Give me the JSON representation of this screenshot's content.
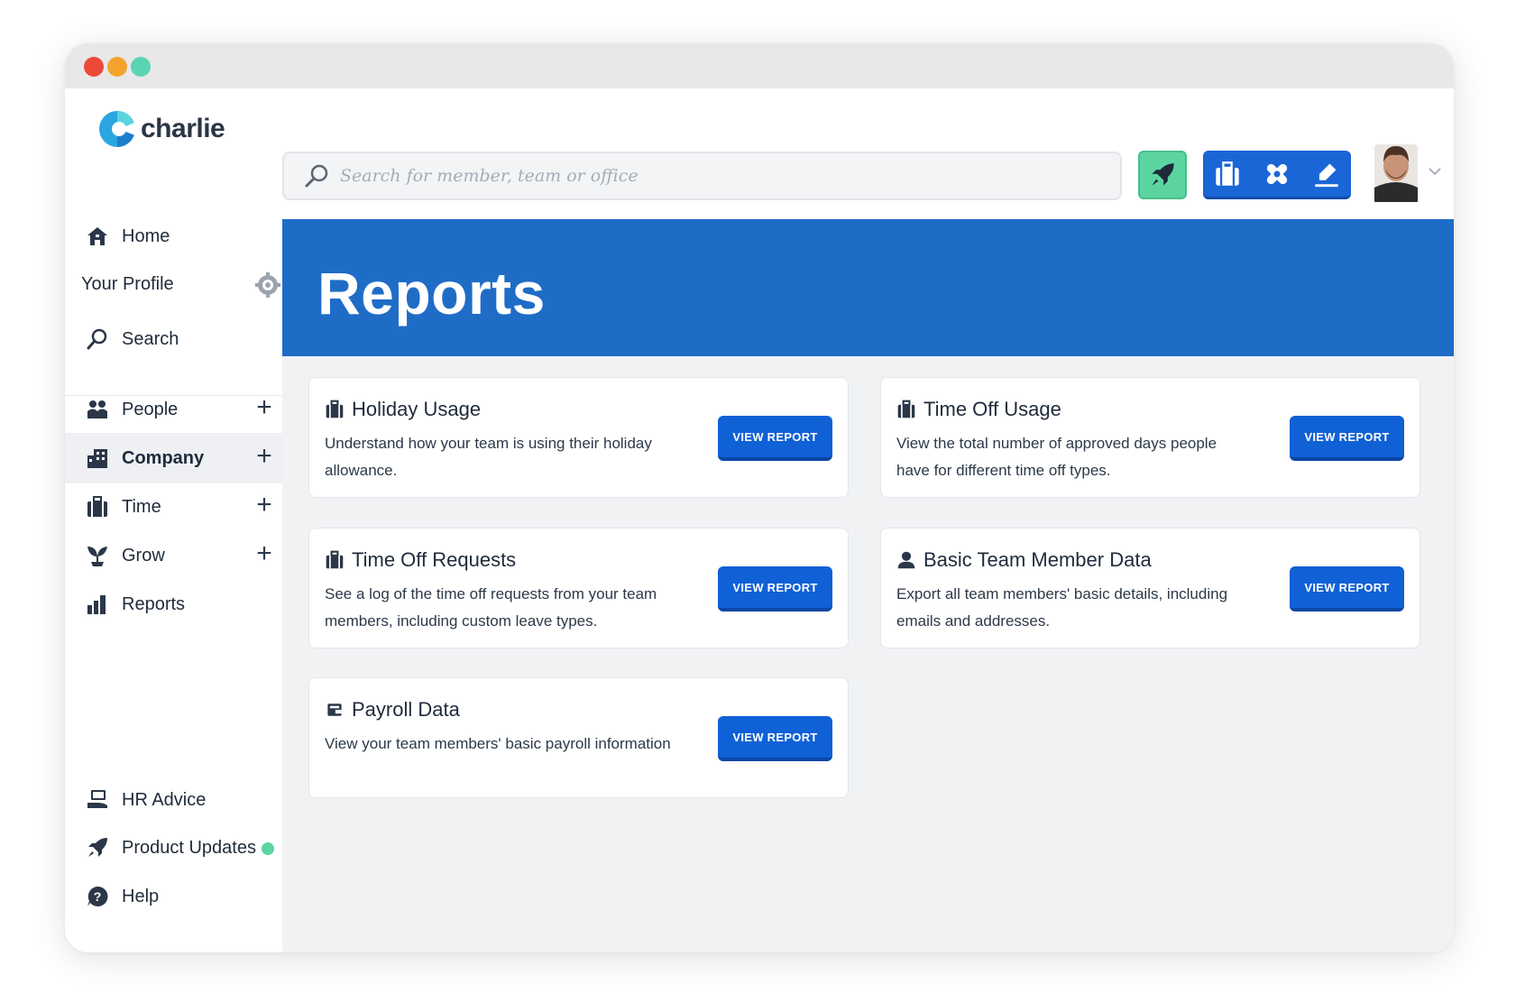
{
  "app": {
    "logo_text": "charlie"
  },
  "search": {
    "placeholder": "Search for member, team or office"
  },
  "sidebar": {
    "items": [
      {
        "label": "Home",
        "icon": "home-icon"
      },
      {
        "label": "Your Profile",
        "icon": "gear-icon"
      },
      {
        "label": "Search",
        "icon": "search-icon"
      },
      {
        "label": "People",
        "icon": "people-icon"
      },
      {
        "label": "Company",
        "icon": "building-icon",
        "active": true
      },
      {
        "label": "Time",
        "icon": "suitcase-icon"
      },
      {
        "label": "Grow",
        "icon": "sprout-icon"
      },
      {
        "label": "Reports",
        "icon": "bar-chart-icon"
      },
      {
        "label": "HR Advice",
        "icon": "hand-laptop-icon"
      },
      {
        "label": "Product Updates",
        "icon": "rocket-icon"
      },
      {
        "label": "Help",
        "icon": "question-bubble-icon"
      }
    ]
  },
  "hero": {
    "title": "Reports"
  },
  "reports": [
    {
      "title": "Holiday Usage",
      "icon": "suitcase-icon",
      "description": "Understand how your team is using their holiday allowance.",
      "button": "VIEW REPORT"
    },
    {
      "title": "Time Off Usage",
      "icon": "suitcase-icon",
      "description": "View the total number of approved days people have for different time off types.",
      "button": "VIEW REPORT"
    },
    {
      "title": "Time Off Requests",
      "icon": "suitcase-icon",
      "description": "See a log of the time off requests from your team members, including custom leave types.",
      "button": "VIEW REPORT"
    },
    {
      "title": "Basic Team Member Data",
      "icon": "person-icon",
      "description": "Export all team members' basic details, including emails and addresses.",
      "button": "VIEW REPORT"
    },
    {
      "title": "Payroll Data",
      "icon": "wallet-icon",
      "description": "View your team members' basic payroll information",
      "button": "VIEW REPORT"
    }
  ],
  "colors": {
    "brand_blue": "#1f6cc7",
    "button_blue": "#1060d6",
    "accent_green": "#5bd4a0"
  }
}
